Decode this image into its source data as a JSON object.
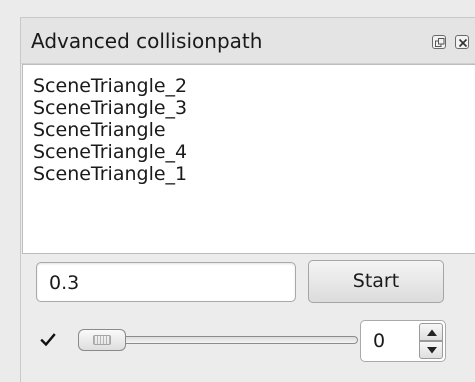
{
  "window": {
    "title": "Advanced collisionpath",
    "float_icon": "float-icon",
    "close_icon": "close-icon"
  },
  "objects_list": {
    "items": [
      "SceneTriangle_2",
      "SceneTriangle_3",
      "SceneTriangle",
      "SceneTriangle_4",
      "SceneTriangle_1"
    ]
  },
  "controls": {
    "value_input": "0.3",
    "start_label": "Start",
    "checkbox_checked": true,
    "slider_position": 0,
    "spin_value": "0"
  }
}
